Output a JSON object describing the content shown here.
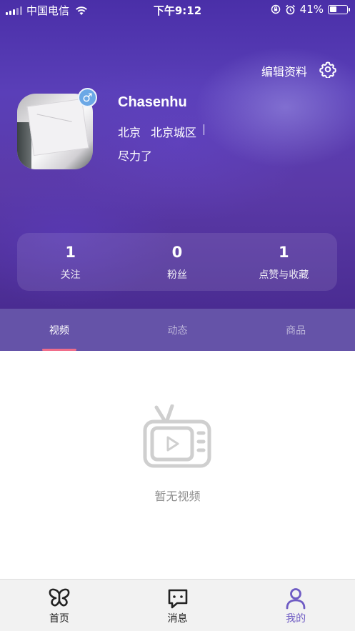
{
  "status_bar": {
    "carrier": "中国电信",
    "time": "下午9:12",
    "battery": "41%",
    "battery_level": 0.41
  },
  "header": {
    "edit_profile_label": "编辑资料",
    "settings_icon": "gear-icon"
  },
  "profile": {
    "username": "Chasenhu",
    "gender_symbol": "♂",
    "city": "北京",
    "district": "北京城区",
    "bio": "尽力了"
  },
  "stats": [
    {
      "value": "1",
      "label": "关注"
    },
    {
      "value": "0",
      "label": "粉丝"
    },
    {
      "value": "1",
      "label": "点赞与收藏"
    }
  ],
  "tabs": [
    {
      "label": "视频",
      "active": true
    },
    {
      "label": "动态",
      "active": false
    },
    {
      "label": "商品",
      "active": false
    }
  ],
  "empty_state": {
    "icon": "tv-icon",
    "text": "暂无视频"
  },
  "bottom_nav": [
    {
      "label": "首页",
      "icon": "butterfly-icon",
      "active": false
    },
    {
      "label": "消息",
      "icon": "message-icon",
      "active": false
    },
    {
      "label": "我的",
      "icon": "user-icon",
      "active": true
    }
  ],
  "colors": {
    "accent": "#6f5cc4",
    "tab_indicator": "#f06d8a",
    "tab_bar_bg": "#6553a8",
    "gender_badge": "#6ba8e6"
  }
}
